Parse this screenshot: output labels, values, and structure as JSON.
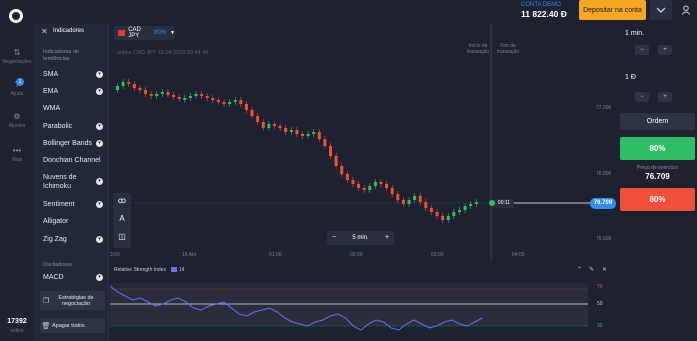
{
  "account": {
    "label": "CONTA DEMO",
    "balance": "11 822.40 Đ",
    "deposit_label": "Depositar na conta"
  },
  "nav": {
    "items": [
      {
        "label": "Negociações",
        "icon": "trades-icon"
      },
      {
        "label": "Ajuda",
        "icon": "help-icon",
        "badge": "1"
      },
      {
        "label": "Ajustes",
        "icon": "gear-icon"
      },
      {
        "label": "Mais",
        "icon": "more-icon"
      }
    ],
    "online_count": "17392",
    "online_label": "online"
  },
  "indicators": {
    "title": "Indicadores",
    "trend_section": "Indicadores de tendências",
    "trend_items": [
      "SMA",
      "EMA",
      "WMA",
      "Parabolic",
      "Bollinger Bands",
      "Donchian Channel",
      "Nuvens de Ichimoku",
      "Sentiment",
      "Alligator",
      "Zig Zag"
    ],
    "osc_section": "Osciladores",
    "osc_items": [
      "MACD"
    ],
    "strategies_label": "Estratégias de negociação",
    "delete_all_label": "Apagar todos"
  },
  "chart": {
    "asset": "CAD JPY",
    "payout": "80%",
    "subtitle": "online CAD JPY 16.04.2025 03:44:49",
    "start_label": "Início da transação",
    "end_label": "Fim da transação",
    "timer": "00:11",
    "current_price": "76.709",
    "time_frame": "5 min.",
    "minus": "−",
    "plus": "+",
    "y_ticks": [
      "77.000",
      "76.800",
      "76.600"
    ],
    "x_ticks": [
      "3:00",
      "16 Abr",
      "01:00",
      "02:00",
      "03:00",
      "04:00"
    ]
  },
  "rsi": {
    "title": "Relative Strength Index",
    "period": "14",
    "levels": [
      "70",
      "50",
      "30"
    ]
  },
  "right": {
    "time_value": "1 min.",
    "amount_value": "1 Đ",
    "order_label": "Ordem",
    "up_percent": "80%",
    "strike_label": "Preço de exercício",
    "strike_value": "76.709",
    "down_percent": "80%"
  },
  "colors": {
    "up": "#2ebf65",
    "down": "#f0503a",
    "accent": "#2f8ef0",
    "deposit": "#f5a623",
    "rsi": "#6f6cf5"
  }
}
